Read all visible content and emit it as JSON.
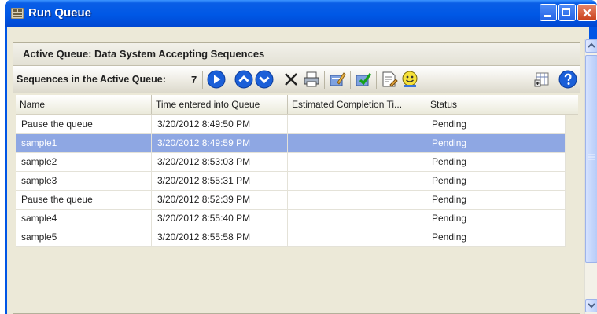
{
  "window": {
    "title": "Run Queue"
  },
  "panel": {
    "active_queue_title": "Active Queue: Data System Accepting Sequences",
    "toolbar": {
      "sequences_label": "Sequences in the Active Queue:",
      "sequence_count": "7"
    }
  },
  "grid": {
    "columns": [
      "Name",
      "Time entered into Queue",
      "Estimated Completion Ti...",
      "Status"
    ],
    "rows": [
      {
        "name": "Pause the queue",
        "time": "3/20/2012 8:49:50 PM",
        "completion": "",
        "status": "Pending"
      },
      {
        "name": "sample1",
        "time": "3/20/2012 8:49:59 PM",
        "completion": "",
        "status": "Pending"
      },
      {
        "name": "sample2",
        "time": "3/20/2012 8:53:03 PM",
        "completion": "",
        "status": "Pending"
      },
      {
        "name": "sample3",
        "time": "3/20/2012 8:55:31 PM",
        "completion": "",
        "status": "Pending"
      },
      {
        "name": "Pause the queue",
        "time": "3/20/2012 8:52:39 PM",
        "completion": "",
        "status": "Pending"
      },
      {
        "name": "sample4",
        "time": "3/20/2012 8:55:40 PM",
        "completion": "",
        "status": "Pending"
      },
      {
        "name": "sample5",
        "time": "3/20/2012 8:55:58 PM",
        "completion": "",
        "status": "Pending"
      }
    ]
  },
  "colors": {
    "titlebar": "#0058e6",
    "selection": "#8ea7e3",
    "toolbar_blue_button": "#1b5fd8"
  },
  "icons": [
    "app-icon",
    "minimize-icon",
    "maximize-icon",
    "close-icon",
    "play-icon",
    "move-up-icon",
    "move-down-icon",
    "delete-icon",
    "print-icon",
    "edit-icon",
    "check-icon",
    "properties-icon",
    "smiley-icon",
    "column-chooser-icon",
    "help-icon"
  ]
}
